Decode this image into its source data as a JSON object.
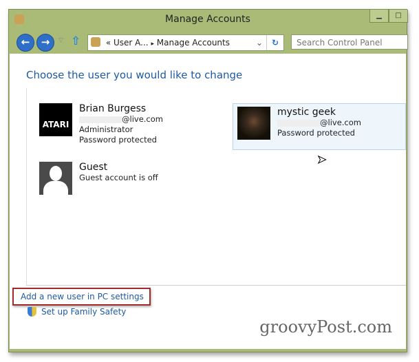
{
  "window": {
    "title": "Manage Accounts",
    "minimize": "▁",
    "maximize": "□"
  },
  "nav": {
    "back": "←",
    "forward": "→",
    "up": "⇧",
    "breadcrumb": [
      "«",
      "User A...",
      "▸",
      "Manage Accounts"
    ],
    "dropdown": "⌄",
    "refresh": "↻",
    "search_placeholder": "Search Control Panel"
  },
  "main": {
    "heading": "Choose the user you would like to change",
    "accounts": [
      {
        "name": "Brian Burgess",
        "email": "@live.com",
        "role": "Administrator",
        "status": "Password protected",
        "avatar_text": "ATARI"
      },
      {
        "name": "mystic geek",
        "email": "@live.com",
        "status": "Password protected"
      },
      {
        "name": "Guest",
        "status": "Guest account is off"
      }
    ]
  },
  "links": {
    "add_user": "Add a new user in PC settings",
    "family_safety": "Set up Family Safety"
  },
  "watermark": "groovyPost.com",
  "colors": {
    "titlebar": "#aabb78",
    "link": "#1e5aa0",
    "highlight_border": "#a32a2a"
  }
}
